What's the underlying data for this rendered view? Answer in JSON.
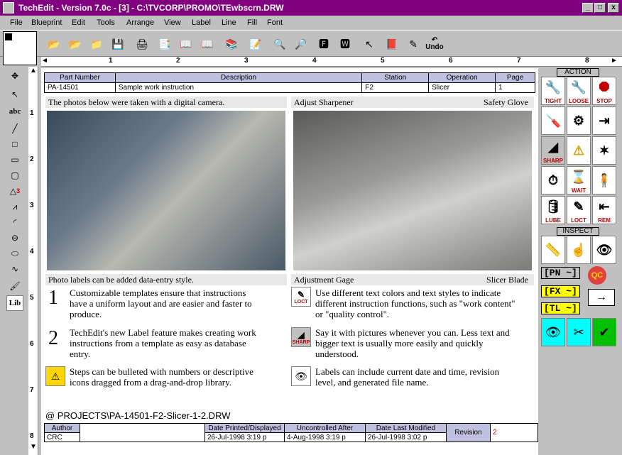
{
  "window": {
    "title": "TechEdit - Version 7.0c - [3] - C:\\TVCORP\\PROMO\\TEwbscrn.DRW",
    "min_label": "_",
    "max_label": "□",
    "close_label": "x"
  },
  "menu": [
    "File",
    "Blueprint",
    "Edit",
    "Tools",
    "Arrange",
    "View",
    "Label",
    "Line",
    "Fill",
    "Font"
  ],
  "toolbar": {
    "undo_label": "Undo"
  },
  "ruler": {
    "h_labels": [
      "1",
      "2",
      "3",
      "4",
      "5",
      "6",
      "7",
      "8"
    ],
    "v_labels": [
      "1",
      "2",
      "3",
      "4",
      "5",
      "6",
      "7",
      "8"
    ]
  },
  "left_tools": {
    "abc_label": "abc",
    "lib_label": "Lib",
    "triangle_badge": "3"
  },
  "header": {
    "col_part": "Part Number",
    "col_desc": "Description",
    "col_station": "Station",
    "col_operation": "Operation",
    "col_page": "Page",
    "part": "PA-14501",
    "desc": "Sample work instruction",
    "station": "F2",
    "operation": "Slicer",
    "page": "1"
  },
  "sections": {
    "photo1_caption": "The photos below were taken with a digital camera.",
    "photo2_left": "Adjust Sharpener",
    "photo2_right": "Safety Glove",
    "label1": "Photo labels can be added data-entry style.",
    "label2_left": "Adjustment Gage",
    "label2_right": "Slicer Blade"
  },
  "steps": [
    {
      "num": "1",
      "text": "Customizable templates ensure that instructions have a uniform layout and are easier and faster to produce."
    },
    {
      "num": "2",
      "text": "TechEdit's new Label feature makes creating work instructions from a template as easy as database entry."
    },
    {
      "num": "",
      "text": "Steps can be bulleted with numbers or descriptive icons dragged from a drag-and-drop library."
    }
  ],
  "steps_right": [
    {
      "icon_label": "LOCT",
      "text": "Use different text colors and text styles to indicate different instruction functions, such as \"work content\" or \"quality control\"."
    },
    {
      "icon_label": "SHARP",
      "text": "Say it with pictures whenever you can. Less text and bigger text is usually more easily and quickly understood."
    },
    {
      "icon_label": "",
      "text": "Labels can include current date and time, revision level, and generated file name."
    }
  ],
  "file_path": "@ PROJECTS\\PA-14501-F2-Slicer-1-2.DRW",
  "footer": {
    "author_label": "Author",
    "author": "CRC",
    "printed_label": "Date Printed/Displayed",
    "printed": "26-Jul-1998 3:19 p",
    "uncontrolled_label": "Uncontrolled After",
    "uncontrolled": "4-Aug-1998 3:19 p",
    "modified_label": "Date Last Modified",
    "modified": "26-Jul-1998 3:02 p",
    "revision_label": "Revision",
    "revision": "2"
  },
  "palette": {
    "action_title": "ACTION",
    "inspect_title": "INSPECT",
    "icons": [
      {
        "label": "TIGHT"
      },
      {
        "label": "LOOSE"
      },
      {
        "label": "STOP"
      },
      {
        "label": "SHARP"
      },
      {
        "label": ""
      },
      {
        "label": ""
      },
      {
        "label": ""
      },
      {
        "label": "WAIT"
      },
      {
        "label": ""
      },
      {
        "label": "LUBE"
      },
      {
        "label": "LOCT"
      },
      {
        "label": "REM"
      }
    ],
    "tag_pn": "[PN ~]",
    "tag_fx": "[FX ~]",
    "tag_tl": "[TL ~]",
    "qc": "QC",
    "accent": "#800080"
  }
}
